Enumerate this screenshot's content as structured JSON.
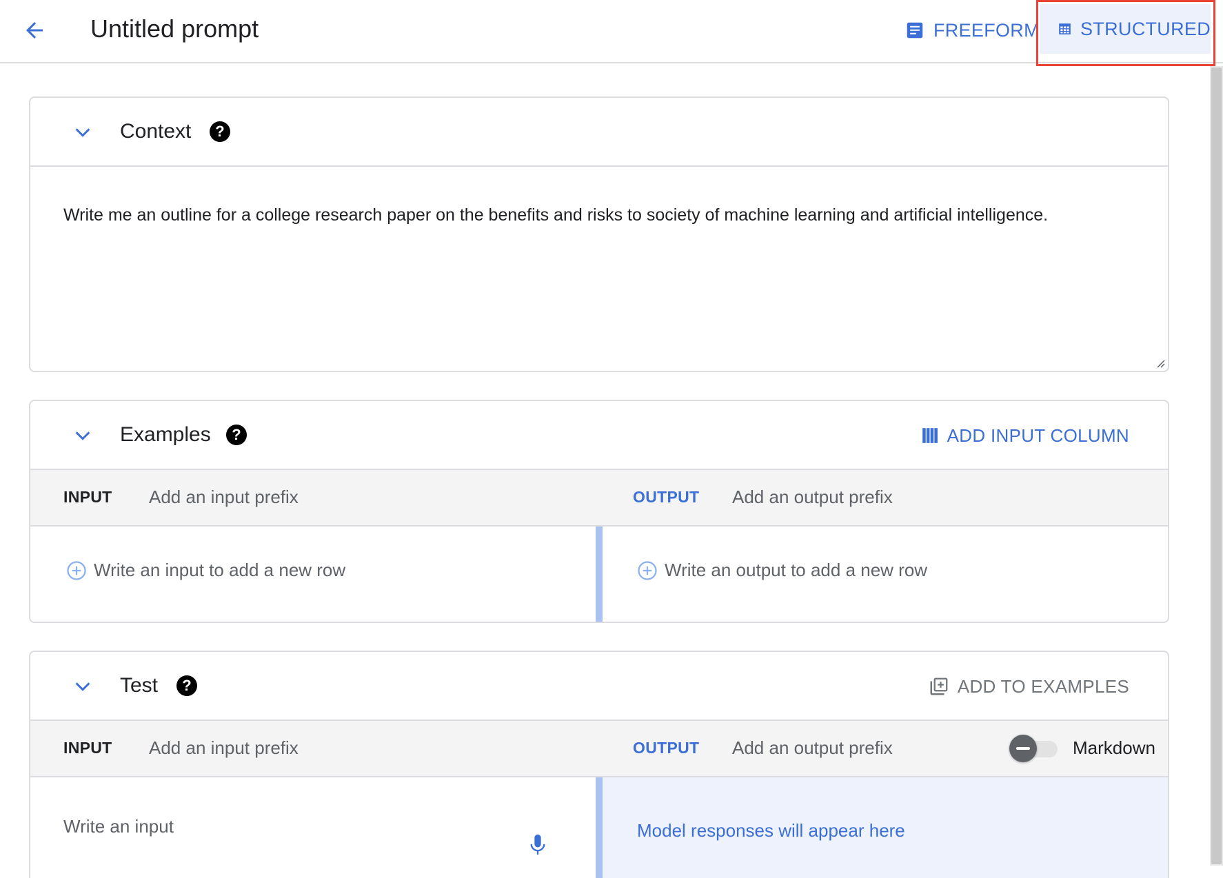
{
  "header": {
    "back_label": "back",
    "title": "Untitled prompt",
    "freeform_label": "FREEFORM",
    "structured_label": "STRUCTURED"
  },
  "context": {
    "title": "Context",
    "text": "Write me an outline for a college research paper on the benefits and risks to society of machine learning and artificial intelligence."
  },
  "examples": {
    "title": "Examples",
    "add_column_label": "ADD INPUT COLUMN",
    "input_label": "INPUT",
    "input_prefix_placeholder": "Add an input prefix",
    "output_label": "OUTPUT",
    "output_prefix_placeholder": "Add an output prefix",
    "add_input_row": "Write an input to add a new row",
    "add_output_row": "Write an output to add a new row"
  },
  "test": {
    "title": "Test",
    "add_to_examples_label": "ADD TO EXAMPLES",
    "input_label": "INPUT",
    "input_prefix_placeholder": "Add an input prefix",
    "output_label": "OUTPUT",
    "output_prefix_placeholder": "Add an output prefix",
    "markdown_label": "Markdown",
    "markdown_enabled": false,
    "input_placeholder": "Write an input",
    "model_response_placeholder": "Model responses will appear here"
  },
  "colors": {
    "accent": "#3c6fd6",
    "highlight": "#ea4335",
    "divider": "#a9c2f0",
    "output_bg": "#edf2fd"
  },
  "icons": [
    "back-arrow-icon",
    "document-icon",
    "table-icon",
    "chevron-down-icon",
    "help-icon",
    "columns-icon",
    "add-circle-icon",
    "library-add-icon",
    "microphone-icon",
    "resize-grip-icon"
  ]
}
